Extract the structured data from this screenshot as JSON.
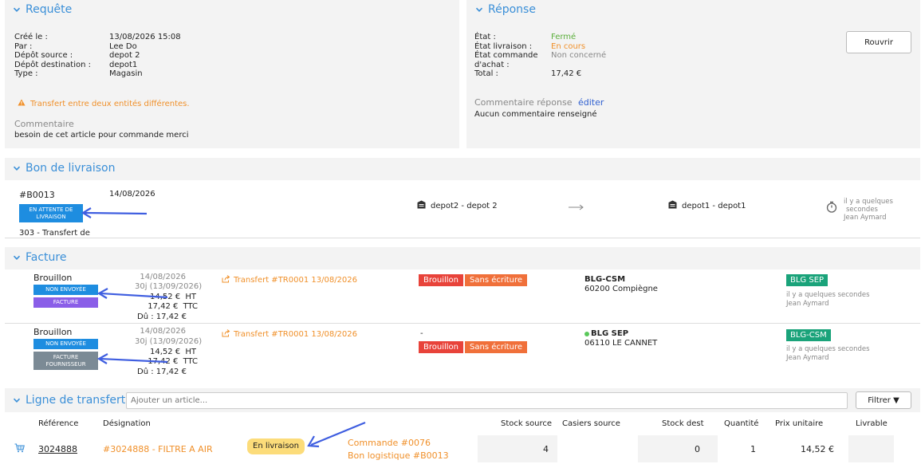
{
  "requete": {
    "title": "Requête",
    "labels": [
      "Créé le :",
      "Par :",
      "Dépôt source :",
      "Dépôt destination :",
      "Type :"
    ],
    "values": [
      "13/08/2026 15:08",
      "Lee Do",
      "depot 2",
      "depot1",
      "Magasin"
    ],
    "warning": "Transfert entre deux entités différentes.",
    "comment_label": "Commentaire",
    "comment": "besoin de cet article pour commande merci"
  },
  "reponse": {
    "title": "Réponse",
    "etat_label": "État :",
    "etat_value": "Fermé",
    "livraison_label": "État livraison :",
    "livraison_value": "En cours",
    "commande_label_1": "État commande",
    "commande_label_2": "d'achat :",
    "commande_value": "Non concerné",
    "total_label": "Total :",
    "total_value": "17,42 €",
    "comment_label": "Commentaire réponse",
    "edit_link": "éditer",
    "comment": "Aucun commentaire renseigné",
    "reopen_button": "Rouvrir"
  },
  "bon": {
    "title": "Bon de livraison",
    "number": "#B0013",
    "date": "14/08/2026",
    "status_line1": "EN ATTENTE DE",
    "status_line2": "LIVRAISON",
    "desc": "303 - Transfert de",
    "from": "depot2 - depot 2",
    "to": "depot1 - depot1",
    "time_line1": "il y a quelques",
    "time_line2": "secondes",
    "user": "Jean Aymard"
  },
  "facture": {
    "title": "Facture",
    "rows": [
      {
        "status": "Brouillon",
        "badge1": "NON ENVOYÉE",
        "badge2_line1": "FACTURE",
        "badge2_line2": "",
        "date": "14/08/2026",
        "due": "30j (13/09/2026)",
        "ht": "14,52 €",
        "ht_label": "HT",
        "ttc": "17,42 €",
        "ttc_label": "TTC",
        "du": "Dû : 17,42 €",
        "transfer": "Transfert #TR0001 13/08/2026",
        "dash": "",
        "tag1": "Brouillon",
        "tag2": "Sans écriture",
        "company": "BLG-CSM",
        "address": "60200 Compiègne",
        "entity": "BLG SEP",
        "time": "il y a quelques secondes",
        "user": "Jean Aymard"
      },
      {
        "status": "Brouillon",
        "badge1": "NON ENVOYÉE",
        "badge2_line1": "FACTURE",
        "badge2_line2": "FOURNISSEUR",
        "date": "14/08/2026",
        "due": "30j (13/09/2026)",
        "ht": "14,52 €",
        "ht_label": "HT",
        "ttc": "17,42 €",
        "ttc_label": "TTC",
        "du": "Dû : 17,42 €",
        "transfer": "Transfert #TR0001 13/08/2026",
        "dash": "-",
        "tag1": "Brouillon",
        "tag2": "Sans écriture",
        "company": "BLG SEP",
        "address": "06110 LE CANNET",
        "entity": "BLG-CSM",
        "time": "il y a quelques secondes",
        "user": "Jean Aymard"
      }
    ]
  },
  "lignes": {
    "title": "Ligne de transfert",
    "add_placeholder": "Ajouter un article...",
    "filter_button": "Filtrer ▼",
    "columns": [
      "Référence",
      "Désignation",
      "Stock source",
      "Casiers source",
      "Stock dest",
      "Quantité",
      "Prix unitaire",
      "Livrable"
    ],
    "row": {
      "reference": "3024888",
      "designation": "#3024888 - FILTRE A AIR",
      "status": "En livraison",
      "commande": "Commande #0076",
      "bon": "Bon logistique #B0013",
      "stock_source": "4",
      "stock_dest": "0",
      "quantite": "1",
      "prix": "14,52 €"
    }
  },
  "colors": {
    "accent": "#3a8fd8",
    "orange": "#f0902a",
    "badge_blue": "#1e8de0",
    "badge_purple": "#8a5ee8",
    "badge_gray": "#7b8a95",
    "tag_red": "#e8433a",
    "tag_orange": "#f0703a",
    "entity_green": "#1aa37a",
    "arrow": "#3f5ee0"
  }
}
